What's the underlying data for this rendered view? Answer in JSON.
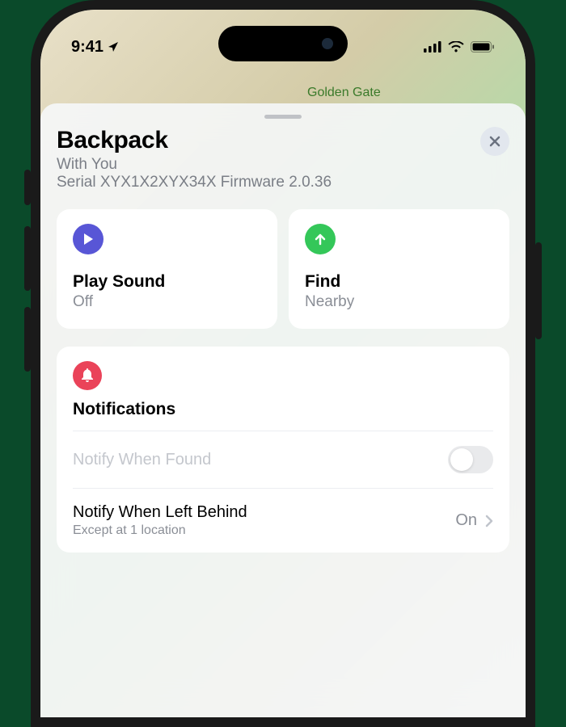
{
  "status": {
    "time": "9:41",
    "location_icon": "location-arrow"
  },
  "map": {
    "visible_label": "Golden Gate"
  },
  "sheet": {
    "title": "Backpack",
    "subtitle": "With You",
    "details": "Serial XYX1X2XYX34X Firmware 2.0.36"
  },
  "actions": {
    "play_sound": {
      "label": "Play Sound",
      "status": "Off"
    },
    "find": {
      "label": "Find",
      "status": "Nearby"
    }
  },
  "notifications": {
    "section_label": "Notifications",
    "when_found": {
      "label": "Notify When Found",
      "enabled": false
    },
    "left_behind": {
      "label": "Notify When Left Behind",
      "sub": "Except at 1 location",
      "value": "On"
    }
  }
}
